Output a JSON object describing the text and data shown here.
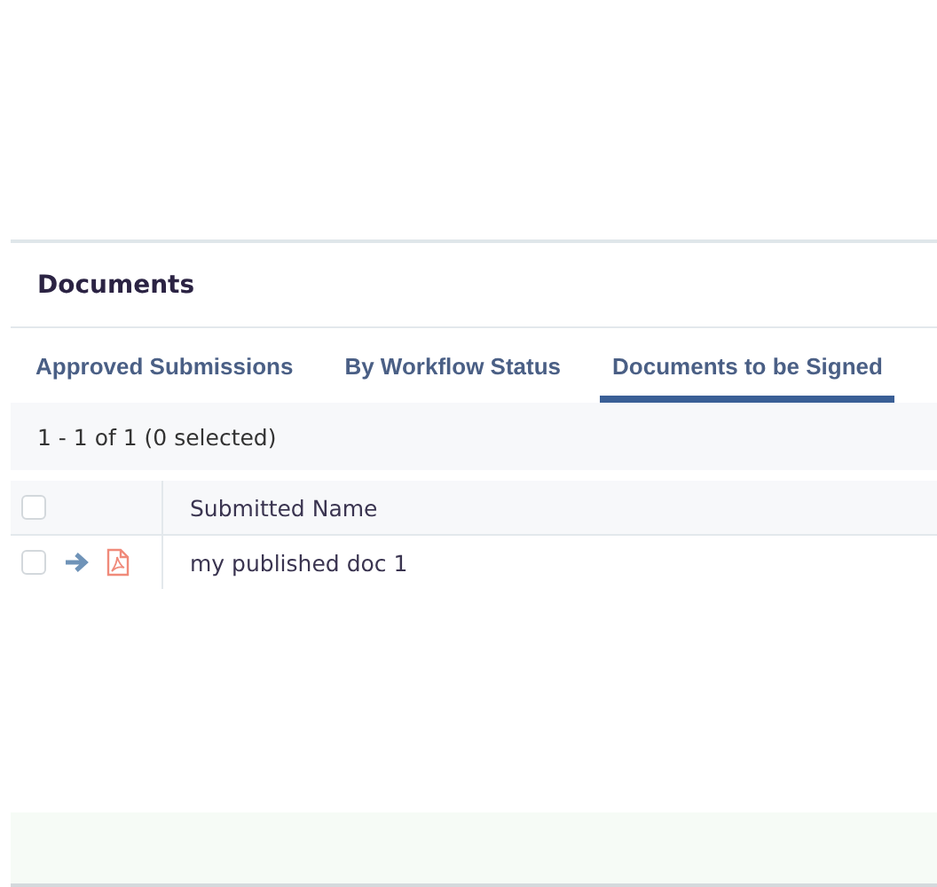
{
  "panel": {
    "title": "Documents"
  },
  "tabs": [
    {
      "label": "Approved Submissions",
      "selected": false
    },
    {
      "label": "By Workflow Status",
      "selected": false
    },
    {
      "label": "Documents to be Signed",
      "selected": true
    }
  ],
  "summary": "1 - 1 of 1 (0 selected)",
  "table": {
    "columns": [
      "Submitted Name"
    ],
    "select_all_checked": false,
    "rows": [
      {
        "checked": false,
        "name": "my published doc 1"
      }
    ]
  }
}
